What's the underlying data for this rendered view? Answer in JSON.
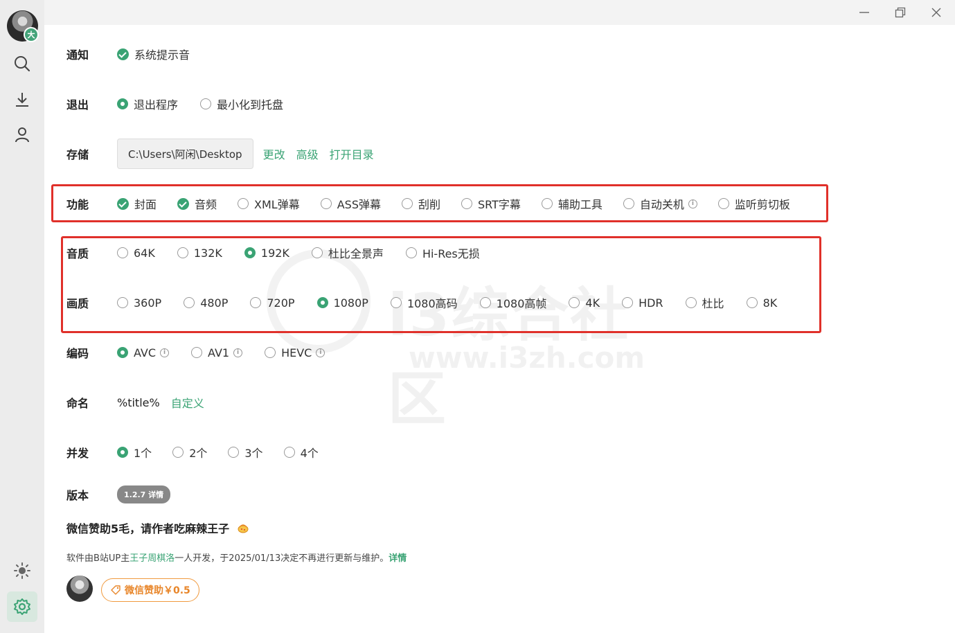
{
  "window": {
    "minimize_icon": "minimize-icon",
    "restore_icon": "restore-icon",
    "close_icon": "close-icon"
  },
  "sidebar": {
    "avatar_badge": "大",
    "items": [
      "search-icon",
      "download-icon",
      "user-icon",
      "theme-icon",
      "settings-icon"
    ],
    "active": "settings-icon"
  },
  "settings": {
    "notify": {
      "label": "通知",
      "options": [
        {
          "text": "系统提示音",
          "checked": true
        }
      ]
    },
    "exit": {
      "label": "退出",
      "options": [
        {
          "text": "退出程序",
          "selected": true
        },
        {
          "text": "最小化到托盘",
          "selected": false
        }
      ]
    },
    "storage": {
      "label": "存储",
      "path": "C:\\Users\\阿闲\\Desktop",
      "links": [
        "更改",
        "高级",
        "打开目录"
      ]
    },
    "features": {
      "label": "功能",
      "options": [
        {
          "text": "封面",
          "checked": true
        },
        {
          "text": "音频",
          "checked": true
        },
        {
          "text": "XML弹幕",
          "checked": false
        },
        {
          "text": "ASS弹幕",
          "checked": false
        },
        {
          "text": "刮削",
          "checked": false
        },
        {
          "text": "SRT字幕",
          "checked": false
        },
        {
          "text": "辅助工具",
          "checked": false
        },
        {
          "text": "自动关机",
          "checked": false,
          "info": "i"
        },
        {
          "text": "监听剪切板",
          "checked": false
        }
      ]
    },
    "audio": {
      "label": "音质",
      "options": [
        {
          "text": "64K",
          "selected": false
        },
        {
          "text": "132K",
          "selected": false
        },
        {
          "text": "192K",
          "selected": true
        },
        {
          "text": "杜比全景声",
          "selected": false
        },
        {
          "text": "Hi-Res无损",
          "selected": false
        }
      ]
    },
    "video": {
      "label": "画质",
      "options": [
        {
          "text": "360P",
          "selected": false
        },
        {
          "text": "480P",
          "selected": false
        },
        {
          "text": "720P",
          "selected": false
        },
        {
          "text": "1080P",
          "selected": true
        },
        {
          "text": "1080高码",
          "selected": false
        },
        {
          "text": "1080高帧",
          "selected": false
        },
        {
          "text": "4K",
          "selected": false
        },
        {
          "text": "HDR",
          "selected": false
        },
        {
          "text": "杜比",
          "selected": false
        },
        {
          "text": "8K",
          "selected": false
        }
      ]
    },
    "codec": {
      "label": "编码",
      "options": [
        {
          "text": "AVC",
          "selected": true,
          "info": "i"
        },
        {
          "text": "AV1",
          "selected": false,
          "info": "i"
        },
        {
          "text": "HEVC",
          "selected": false,
          "info": "i"
        }
      ]
    },
    "naming": {
      "label": "命名",
      "value": "%title%",
      "link": "自定义"
    },
    "concurrency": {
      "label": "并发",
      "options": [
        {
          "text": "1个",
          "selected": true
        },
        {
          "text": "2个",
          "selected": false
        },
        {
          "text": "3个",
          "selected": false
        },
        {
          "text": "4个",
          "selected": false
        }
      ]
    },
    "version": {
      "label": "版本",
      "value": "1.2.7 详情"
    }
  },
  "donate": {
    "line": "微信赞助5毛，请作者吃麻辣王子",
    "note_prefix": "软件由B站UP主",
    "note_author": "王子周棋洛",
    "note_suffix": "一人开发，于2025/01/13决定不再进行更新与维护。",
    "note_link": "详情",
    "button": "微信赞助￥0.5"
  },
  "watermark": {
    "text": "i3综合社区",
    "url": "www.i3zh.com"
  },
  "colors": {
    "accent": "#3aa374",
    "highlight": "#e0302a",
    "donate": "#e8862a"
  }
}
